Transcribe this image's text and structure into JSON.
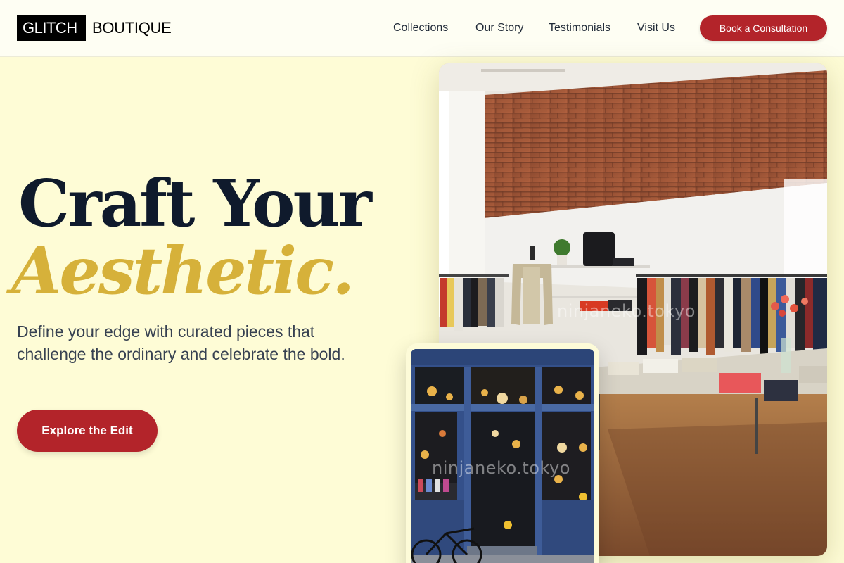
{
  "header": {
    "logo_box": "GLITCH",
    "logo_text": "BOUTIQUE",
    "nav": [
      "Collections",
      "Our Story",
      "Testimonials",
      "Visit Us"
    ],
    "cta": "Book a Consultation"
  },
  "hero": {
    "title_line1": "Craft Your",
    "title_line2": "Aesthetic.",
    "subtitle": "Define your edge with curated pieces that challenge the ordinary and celebrate the bold.",
    "cta": "Explore the Edit"
  },
  "images": {
    "store_watermark": "ninjaneko.tokyo",
    "front_watermark": "ninjaneko.tokyo"
  },
  "colors": {
    "background": "#fefcd6",
    "accent_red": "#b3242a",
    "accent_gold": "#d6b13a",
    "heading_navy": "#0f1a2c"
  }
}
